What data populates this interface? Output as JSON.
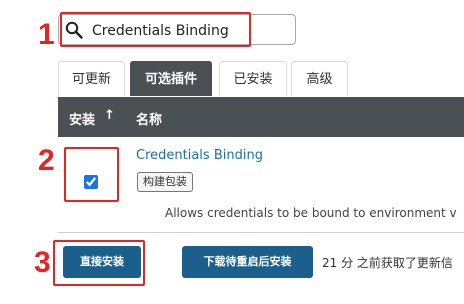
{
  "annotations": {
    "step1": "1",
    "step2": "2",
    "step3": "3",
    "highlight_color": "#e52424"
  },
  "search": {
    "value": "Credentials Binding",
    "icon": "search-icon"
  },
  "tabs": [
    {
      "label": "可更新",
      "active": false
    },
    {
      "label": "可选插件",
      "active": true
    },
    {
      "label": "已安装",
      "active": false
    },
    {
      "label": "高级",
      "active": false
    }
  ],
  "table": {
    "headers": {
      "install": "安装",
      "sort_indicator": "↑",
      "name": "名称"
    },
    "rows": [
      {
        "checked": true,
        "name": "Credentials Binding",
        "tag": "构建包装",
        "description": "Allows credentials to be bound to environment v"
      }
    ]
  },
  "footer": {
    "install_button": "直接安装",
    "restart_button": "下载待重启后安装",
    "status": "21 分 之前获取了更新信"
  },
  "colors": {
    "header_bg": "#4b5054",
    "button_bg": "#1b5f8c",
    "link": "#1b6fa8"
  }
}
